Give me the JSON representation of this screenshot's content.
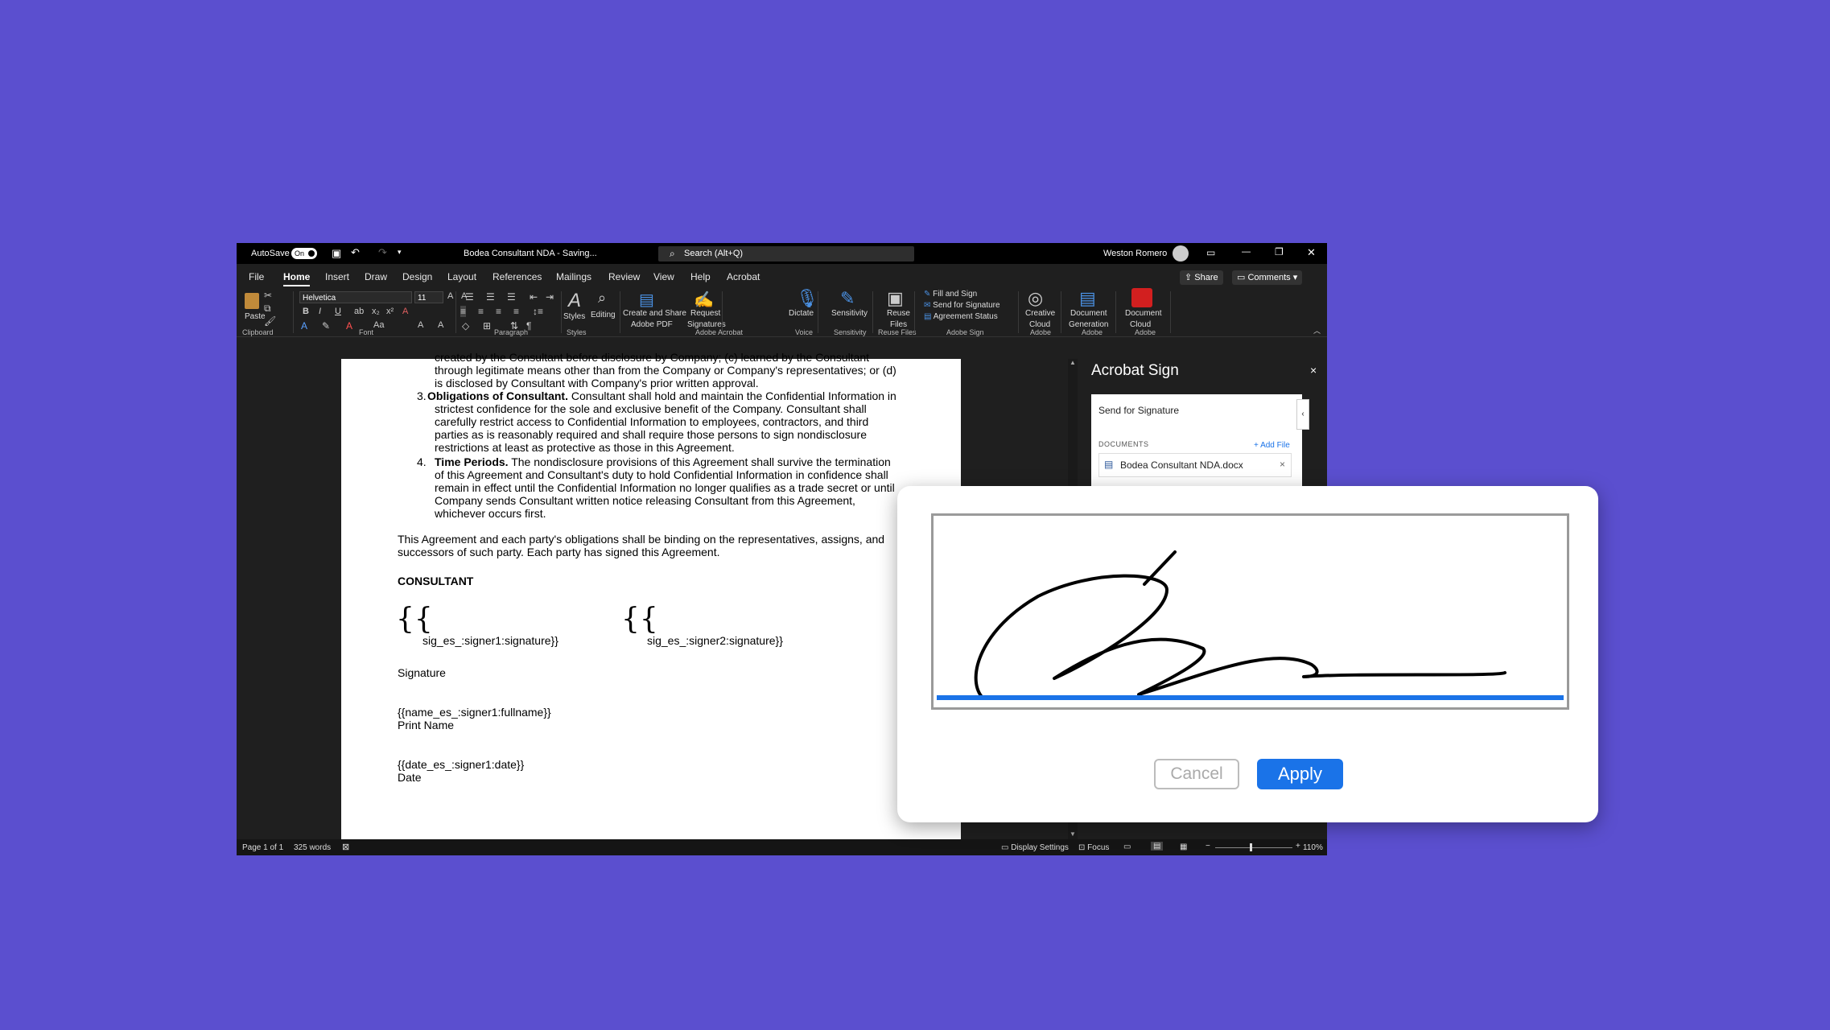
{
  "titlebar": {
    "autosave": "AutoSave",
    "toggle": "On",
    "doc_title": "Bodea Consultant NDA  -  Saving...",
    "search": "Search (Alt+Q)",
    "user": "Weston Romero"
  },
  "tabs": [
    "File",
    "Home",
    "Insert",
    "Draw",
    "Design",
    "Layout",
    "References",
    "Mailings",
    "Review",
    "View",
    "Help",
    "Acrobat"
  ],
  "share_label": "Share",
  "comments_label": "Comments",
  "ribbon": {
    "paste": "Paste",
    "font_name": "Helvetica",
    "font_size": "11",
    "styles": "Styles",
    "editing": "Editing",
    "create_share": "Create and Share",
    "create_share2": "Adobe PDF",
    "request": "Request",
    "request2": "Signatures",
    "dictate": "Dictate",
    "sensitivity": "Sensitivity",
    "reuse": "Reuse",
    "reuse2": "Files",
    "fill_sign": "Fill and Sign",
    "send_sig": "Send for Signature",
    "agreement": "Agreement Status",
    "creative": "Creative",
    "creative2": "Cloud",
    "docgen": "Document",
    "docgen2": "Generation",
    "doccloud": "Document",
    "doccloud2": "Cloud",
    "groups": {
      "clipboard": "Clipboard",
      "font": "Font",
      "paragraph": "Paragraph",
      "styles": "Styles",
      "adobe_acrobat": "Adobe Acrobat",
      "voice": "Voice",
      "sensitivity": "Sensitivity",
      "reuse_files": "Reuse Files",
      "adobe_sign": "Adobe Sign",
      "adobe1": "Adobe",
      "adobe2": "Adobe",
      "adobe3": "Adobe"
    }
  },
  "document": {
    "line0": "created by the Consultant before disclosure by Company; (c) learned by the Consultant",
    "line1": "through legitimate means other than from the Company or Company's representatives; or (d)",
    "line2": "is disclosed by Consultant with Company's prior written approval.",
    "item3_num": "3.",
    "item3_bold": "Obligations of Consultant.",
    "item3_rest": " Consultant shall hold and maintain the Confidential Information in",
    "item3_l2": "strictest confidence for the sole and exclusive benefit of the Company. Consultant shall",
    "item3_l3": "carefully restrict access to Confidential Information to employees, contractors, and third",
    "item3_l4": "parties as is reasonably required and shall require those persons to sign nondisclosure",
    "item3_l5": "restrictions at least as protective as those in this Agreement.",
    "item4_num": "4.",
    "item4_bold": "Time Periods.",
    "item4_rest": " The nondisclosure provisions of this Agreement shall survive the termination",
    "item4_l2": "of this Agreement and Consultant's duty to hold Confidential Information in confidence shall",
    "item4_l3": "remain in effect until the Confidential Information no longer qualifies as a trade secret or until",
    "item4_l4": "Company sends Consultant written notice releasing Consultant from this Agreement,",
    "item4_l5": "whichever occurs first.",
    "para1": "This Agreement and each party's obligations shall be binding on the representatives, assigns, and",
    "para2": "successors of such party. Each party has signed this Agreement.",
    "consultant": "CONSULTANT",
    "brace": "{{",
    "sig1": "sig_es_:signer1:signature}}",
    "sig2": "sig_es_:signer2:signature}}",
    "signature_label": "Signature",
    "name_tag": "{{name_es_:signer1:fullname}}",
    "print_name": "Print Name",
    "date_tag": "{{date_es_:signer1:date}}",
    "date_label": "Date"
  },
  "acrobat_pane": {
    "title": "Acrobat Sign",
    "close": "×",
    "send": "Send for Signature",
    "documents": "DOCUMENTS",
    "add_file": "+ Add File",
    "file_name": "Bodea Consultant NDA.docx",
    "remove": "×"
  },
  "statusbar": {
    "page": "Page 1 of 1",
    "words": "325 words",
    "display": "Display Settings",
    "focus": "Focus",
    "zoom": "110%"
  },
  "signature_dialog": {
    "cancel": "Cancel",
    "apply": "Apply",
    "accent": "#1a73e8"
  }
}
